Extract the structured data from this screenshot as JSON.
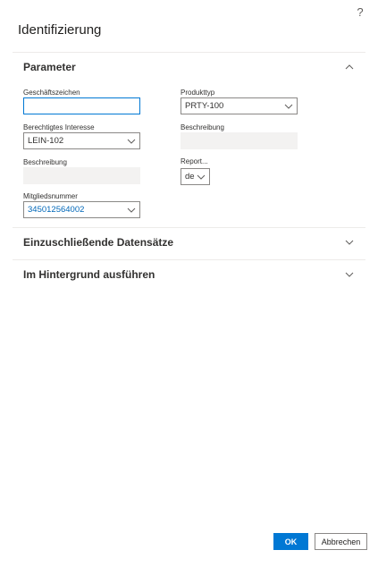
{
  "dialog": {
    "title": "Identifizierung",
    "help_label": "?"
  },
  "sections": {
    "parameter": {
      "label": "Parameter",
      "expanded": true
    },
    "records": {
      "label": "Einzuschließende Datensätze",
      "expanded": false
    },
    "background": {
      "label": "Im Hintergrund ausführen",
      "expanded": false
    }
  },
  "fields": {
    "geschaeftszeichen": {
      "label": "Geschäftszeichen",
      "value": ""
    },
    "produkttyp": {
      "label": "Produkttyp",
      "value": "PRTY-100"
    },
    "berechtigtes_interesse": {
      "label": "Berechtigtes Interesse",
      "value": "LEIN-102"
    },
    "beschreibung_right": {
      "label": "Beschreibung",
      "value": ""
    },
    "beschreibung_left": {
      "label": "Beschreibung",
      "value": ""
    },
    "report": {
      "label": "Report...",
      "value": "de"
    },
    "mitgliedsnummer": {
      "label": "Mitgliedsnummer",
      "value": "345012564002"
    }
  },
  "buttons": {
    "ok": "OK",
    "cancel": "Abbrechen"
  },
  "colors": {
    "accent": "#0078d4",
    "link": "#0067b8",
    "readonly_bg": "#f3f2f1"
  }
}
